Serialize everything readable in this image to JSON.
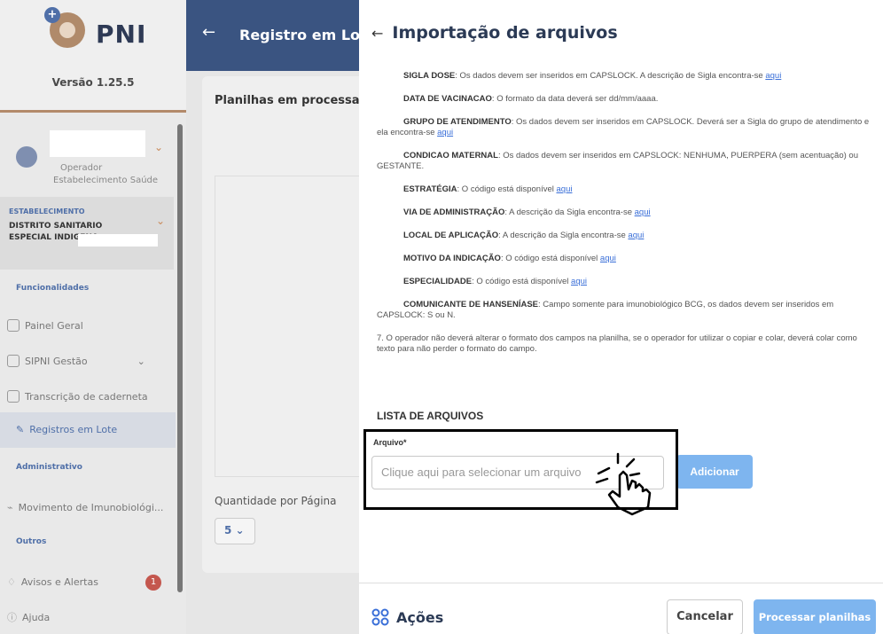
{
  "sidebar": {
    "logo_text": "PNI",
    "version": "Versão 1.25.5",
    "user_role_line1": "Operador",
    "user_role_line2": "Estabelecimento Saúde",
    "estab_title": "ESTABELECIMENTO",
    "estab_name": "DISTRITO SANITARIO ESPECIAL INDIGENA",
    "section_funcionalidades": "Funcionalidades",
    "item_painel": "Painel Geral",
    "item_sipni": "SIPNI Gestão",
    "item_transcricao": "Transcrição de caderneta",
    "item_registros": "Registros em Lote",
    "section_admin": "Administrativo",
    "item_movimento": "Movimento de Imunobiológi...",
    "section_outros": "Outros",
    "item_avisos": "Avisos e Alertas",
    "avisos_count": "1",
    "item_ajuda": "Ajuda"
  },
  "middle": {
    "title": "Registro em Lot",
    "card_title": "Planilhas em processa",
    "qpp_label": "Quantidade por Página",
    "qpp_value": "5"
  },
  "drawer": {
    "title": "Importação de arquivos",
    "instructions": [
      {
        "label": "SIGLA DOSE",
        "text": ": Os dados devem ser inseridos em CAPSLOCK. A descrição de Sigla encontra-se ",
        "link": "aqui"
      },
      {
        "label": "DATA DE VACINACAO",
        "text": ": O formato da data deverá ser dd/mm/aaaa.",
        "link": ""
      },
      {
        "label": "GRUPO DE ATENDIMENTO",
        "text": ": Os dados devem ser inseridos em CAPSLOCK. Deverá ser a Sigla do grupo de atendimento e ela encontra-se ",
        "link": "aqui"
      },
      {
        "label": "CONDICAO MATERNAL",
        "text": ": Os dados devem ser inseridos em CAPSLOCK: NENHUMA, PUERPERA (sem acentuação) ou GESTANTE.",
        "link": ""
      },
      {
        "label": "ESTRATÉGIA",
        "text": ": O código está disponível ",
        "link": "aqui"
      },
      {
        "label": "VIA DE ADMINISTRAÇÃO",
        "text": ": A descrição da Sigla encontra-se ",
        "link": "aqui"
      },
      {
        "label": "LOCAL DE APLICAÇÃO",
        "text": ": A descrição da Sigla encontra-se ",
        "link": "aqui"
      },
      {
        "label": "MOTIVO DA INDICAÇÃO",
        "text": ": O código está disponível ",
        "link": "aqui"
      },
      {
        "label": "ESPECIALIDADE",
        "text": ": O código está disponível ",
        "link": "aqui"
      },
      {
        "label": "COMUNICANTE DE HANSENÍASE",
        "text": ": Campo somente para imunobiológico BCG, os dados devem ser inseridos em CAPSLOCK: S ou N.",
        "link": ""
      }
    ],
    "note7": "7. O operador não deverá alterar o formato dos campos na planilha, se o operador for utilizar o copiar e colar, deverá colar como texto para não perder o formato do campo.",
    "list_title": "LISTA DE ARQUIVOS",
    "file_label": "Arquivo*",
    "file_placeholder": "Clique aqui para selecionar um arquivo",
    "add_button": "Adicionar",
    "actions_label": "Ações",
    "cancel_button": "Cancelar",
    "process_button": "Processar planilhas"
  }
}
